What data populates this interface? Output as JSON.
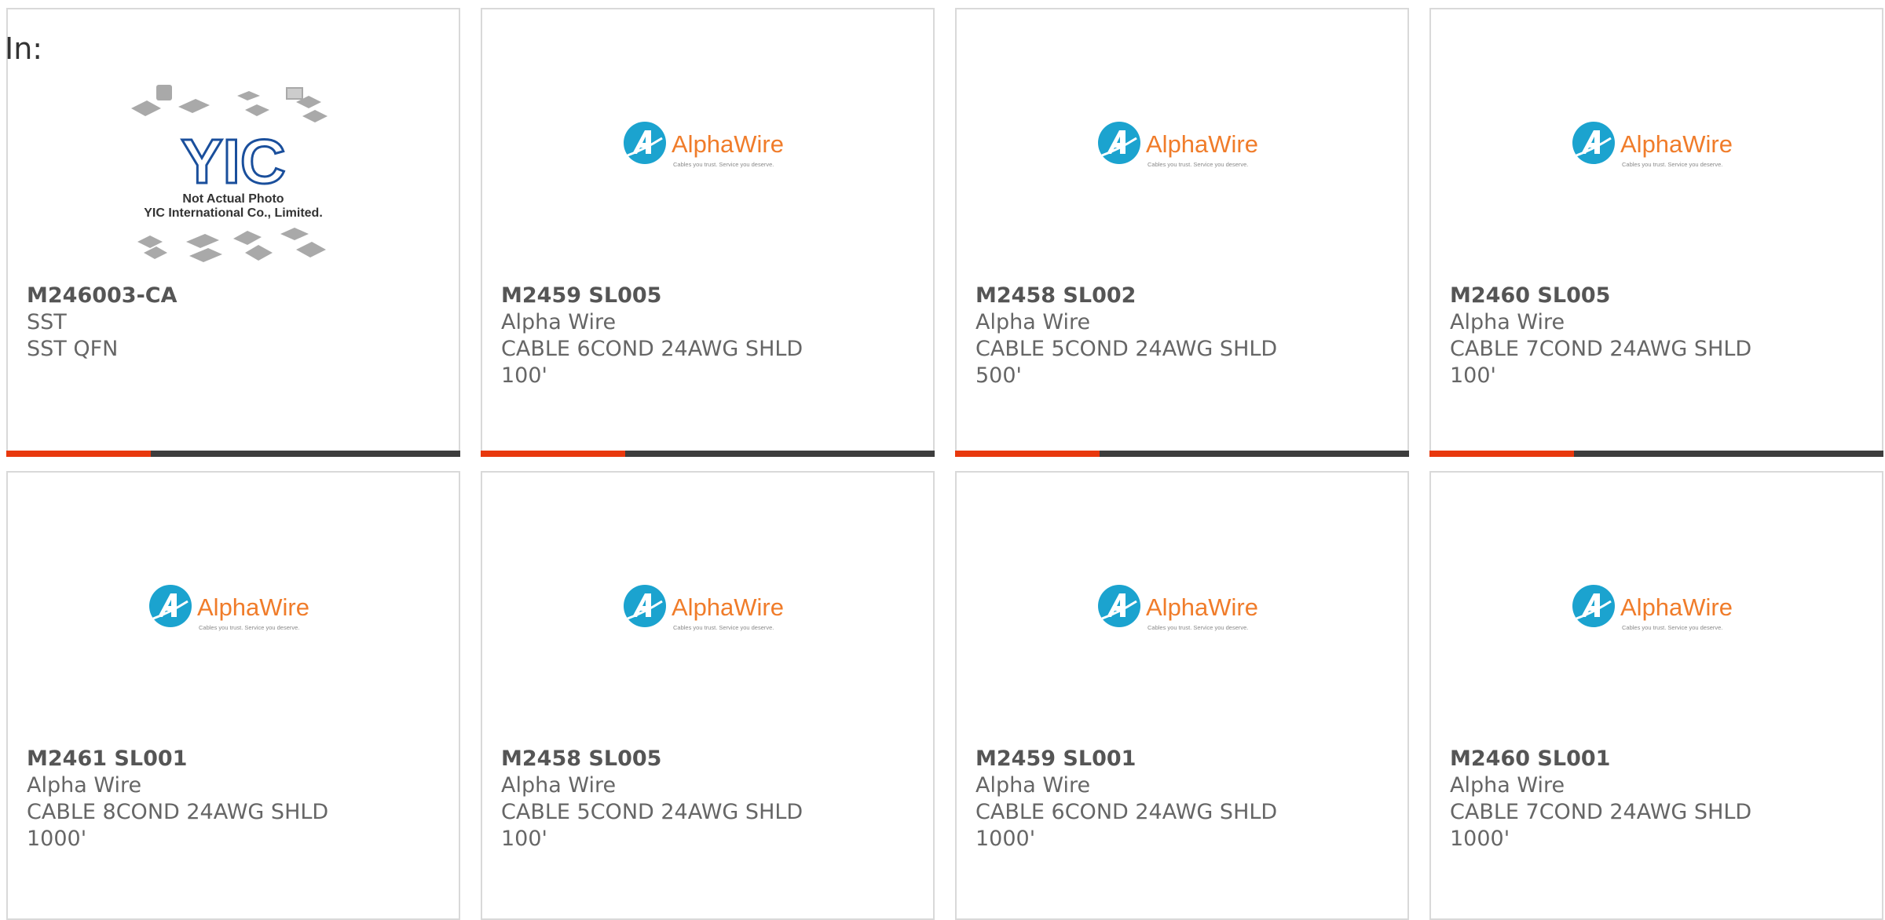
{
  "header": {
    "in_label": "In:"
  },
  "brand": {
    "alpha_name": "AlphaWire",
    "alpha_tagline": "Cables you trust. Service you deserve.",
    "alpha_colors": {
      "circle": "#1ba3cf",
      "text": "#f07c2a",
      "tagline": "#8a8a8a"
    },
    "yic_line1": "Not Actual Photo",
    "yic_line2": "YIC International Co., Limited.",
    "yic_logo_text": "YIC",
    "yic_colors": {
      "logo": "#1a4f9c",
      "chips": "#a9a9a9",
      "text": "#333333"
    }
  },
  "bar_colors": {
    "accent": "#e8380d",
    "track": "#3d3d3d"
  },
  "products": [
    {
      "part_number": "M246003-CA",
      "manufacturer": "SST",
      "description": "SST QFN",
      "image": "yic-placeholder",
      "has_bar": true
    },
    {
      "part_number": "M2459 SL005",
      "manufacturer": "Alpha Wire",
      "description": "CABLE 6COND 24AWG SHLD 100'",
      "image": "alphawire-logo",
      "has_bar": true
    },
    {
      "part_number": "M2458 SL002",
      "manufacturer": "Alpha Wire",
      "description": "CABLE 5COND 24AWG SHLD 500'",
      "image": "alphawire-logo",
      "has_bar": true
    },
    {
      "part_number": "M2460 SL005",
      "manufacturer": "Alpha Wire",
      "description": "CABLE 7COND 24AWG SHLD 100'",
      "image": "alphawire-logo",
      "has_bar": true
    },
    {
      "part_number": "M2461 SL001",
      "manufacturer": "Alpha Wire",
      "description": "CABLE 8COND 24AWG SHLD 1000'",
      "image": "alphawire-logo",
      "has_bar": false
    },
    {
      "part_number": "M2458 SL005",
      "manufacturer": "Alpha Wire",
      "description": "CABLE 5COND 24AWG SHLD 100'",
      "image": "alphawire-logo",
      "has_bar": false
    },
    {
      "part_number": "M2459 SL001",
      "manufacturer": "Alpha Wire",
      "description": "CABLE 6COND 24AWG SHLD 1000'",
      "image": "alphawire-logo",
      "has_bar": false
    },
    {
      "part_number": "M2460 SL001",
      "manufacturer": "Alpha Wire",
      "description": "CABLE 7COND 24AWG SHLD 1000'",
      "image": "alphawire-logo",
      "has_bar": false
    }
  ]
}
